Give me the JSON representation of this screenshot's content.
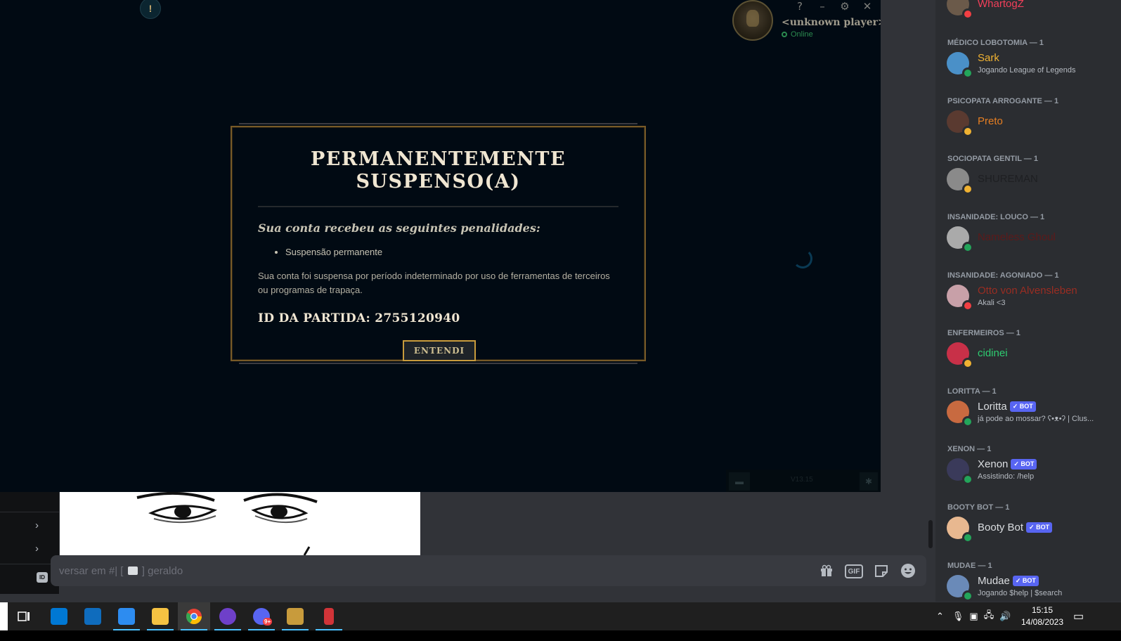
{
  "league": {
    "alert_glyph": "!",
    "window_controls": [
      "?",
      "–",
      "⚙",
      "✕"
    ],
    "profile": {
      "name": "<unknown player>",
      "status": "Online"
    },
    "modal": {
      "title_line1": "PERMANENTEMENTE",
      "title_line2": "SUSPENSO(A)",
      "subtitle": "Sua conta recebeu as seguintes penalidades:",
      "penalties": [
        "Suspensão permanente"
      ],
      "body": "Sua conta foi suspensa por período indeterminado por uso de ferramentas de terceiros ou programas de trapaça.",
      "match_id": "ID DA PARTIDA: 2755120940",
      "button": "ENTENDI"
    },
    "bottom_bar": {
      "version": "V13.15"
    }
  },
  "discord": {
    "popout": {
      "chevrons": [
        "›",
        "›"
      ],
      "id_badge": "ID"
    },
    "input": {
      "placeholder_prefix": "versar em #|",
      "placeholder_bracket_open": "[",
      "placeholder_bracket_close": "]",
      "placeholder_suffix": "geraldo",
      "gif_label": "GIF"
    },
    "member_list": [
      {
        "group": "",
        "name": "WhartogZ",
        "name_color": "#f23f5a",
        "activity": "",
        "status": "dnd",
        "avatar_color": "#6b5a4a",
        "bot": false
      },
      {
        "group": "MÉDICO LOBOTOMIA — 1",
        "name": "Sark",
        "name_color": "#f0b232",
        "activity": "Jogando League of Legends",
        "status": "online",
        "avatar_color": "#4a90c8",
        "bot": false
      },
      {
        "group": "PSICOPATA ARROGANTE — 1",
        "name": "Preto",
        "name_color": "#e67e22",
        "activity": "",
        "status": "idle",
        "avatar_color": "#5a3a30",
        "bot": false
      },
      {
        "group": "SOCIOPATA GENTIL — 1",
        "name": "SHUREMAN",
        "name_color": "#1e1f22",
        "activity": "",
        "status": "idle",
        "avatar_color": "#8a8a8a",
        "bot": false
      },
      {
        "group": "INSANIDADE: LOUCO — 1",
        "name": "Nameless Ghoul",
        "name_color": "#5c1a1a",
        "activity": "",
        "status": "online",
        "avatar_color": "#aaaaaa",
        "bot": false
      },
      {
        "group": "INSANIDADE: AGONIADO — 1",
        "name": "Otto von Alvensleben",
        "name_color": "#992d22",
        "activity": "Akali <3",
        "status": "dnd",
        "avatar_color": "#c8a0a8",
        "bot": false
      },
      {
        "group": "ENFERMEIROS — 1",
        "name": "cidinei",
        "name_color": "#2ecc71",
        "activity": "",
        "status": "idle",
        "avatar_color": "#c83048",
        "bot": false
      },
      {
        "group": "LORITTA — 1",
        "name": "Loritta",
        "name_color": "#dbdee1",
        "activity": "já pode ao mossar? ʕ•ᴥ•ʔ | Clus...",
        "status": "online",
        "avatar_color": "#c86a40",
        "bot": true
      },
      {
        "group": "XENON — 1",
        "name": "Xenon",
        "name_color": "#dbdee1",
        "activity": "Assistindo: /help",
        "status": "online",
        "avatar_color": "#3a3a5a",
        "bot": true
      },
      {
        "group": "BOOTY BOT — 1",
        "name": "Booty Bot",
        "name_color": "#dbdee1",
        "activity": "",
        "status": "online",
        "avatar_color": "#e8b890",
        "bot": true
      },
      {
        "group": "MUDAE — 1",
        "name": "Mudae",
        "name_color": "#dbdee1",
        "activity": "Jogando $help | $search",
        "status": "online",
        "avatar_color": "#6a8ab8",
        "bot": true
      }
    ],
    "bot_badge": "✓ BOT"
  },
  "colors": {
    "online": "#23a55a",
    "idle": "#f0b232",
    "dnd": "#f23f43"
  },
  "taskbar": {
    "apps": [
      {
        "name": "task-view",
        "color": "#ffffff"
      },
      {
        "name": "microsoft-store",
        "color": "#0078d4"
      },
      {
        "name": "mail",
        "color": "#0f6cbd"
      },
      {
        "name": "vscode",
        "color": "#2d8cf0"
      },
      {
        "name": "file-explorer",
        "color": "#f5c242"
      },
      {
        "name": "chrome",
        "color": "#e94235"
      },
      {
        "name": "github-desktop",
        "color": "#6e40c9"
      },
      {
        "name": "discord",
        "color": "#5865f2"
      },
      {
        "name": "league-of-legends",
        "color": "#c89b3c"
      },
      {
        "name": "tool",
        "color": "#d13438"
      }
    ],
    "discord_badge": "9+",
    "time": "15:15",
    "date": "14/08/2023"
  }
}
